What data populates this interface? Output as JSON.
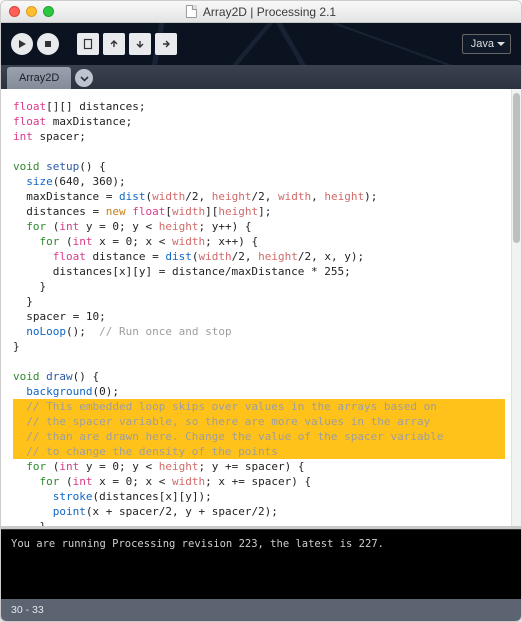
{
  "window": {
    "title": "Array2D | Processing 2.1"
  },
  "toolbar": {
    "mode_label": "Java"
  },
  "tabs": {
    "items": [
      {
        "label": "Array2D"
      }
    ]
  },
  "console": {
    "message": "You are running Processing revision 223, the latest is 227."
  },
  "status": {
    "selection": "30 - 33"
  },
  "code": {
    "l1_a": "float",
    "l1_b": "[][] distances;",
    "l2_a": "float",
    "l2_b": " maxDistance;",
    "l3_a": "int",
    "l3_b": " spacer;",
    "blank": " ",
    "l5_a": "void",
    "l5_b": " ",
    "l5_c": "setup",
    "l5_d": "() {",
    "l6_a": "  ",
    "l6_b": "size",
    "l6_c": "(640, 360);",
    "l7_a": "  maxDistance = ",
    "l7_b": "dist",
    "l7_c": "(",
    "l7_d": "width",
    "l7_e": "/2, ",
    "l7_f": "height",
    "l7_g": "/2, ",
    "l7_h": "width",
    "l7_i": ", ",
    "l7_j": "height",
    "l7_k": ");",
    "l8_a": "  distances = ",
    "l8_b": "new",
    "l8_c": " ",
    "l8_d": "float",
    "l8_e": "[",
    "l8_f": "width",
    "l8_g": "][",
    "l8_h": "height",
    "l8_i": "];",
    "l9_a": "  ",
    "l9_b": "for",
    "l9_c": " (",
    "l9_d": "int",
    "l9_e": " y = 0; y < ",
    "l9_f": "height",
    "l9_g": "; y++) {",
    "l10_a": "    ",
    "l10_b": "for",
    "l10_c": " (",
    "l10_d": "int",
    "l10_e": " x = 0; x < ",
    "l10_f": "width",
    "l10_g": "; x++) {",
    "l11_a": "      ",
    "l11_b": "float",
    "l11_c": " distance = ",
    "l11_d": "dist",
    "l11_e": "(",
    "l11_f": "width",
    "l11_g": "/2, ",
    "l11_h": "height",
    "l11_i": "/2, x, y);",
    "l12": "      distances[x][y] = distance/maxDistance * 255;",
    "l13": "    }",
    "l14": "  }",
    "l15": "  spacer = 10;",
    "l16_a": "  ",
    "l16_b": "noLoop",
    "l16_c": "();  ",
    "l16_d": "// Run once and stop",
    "l17": "}",
    "l19_a": "void",
    "l19_b": " ",
    "l19_c": "draw",
    "l19_d": "() {",
    "l20_a": "  ",
    "l20_b": "background",
    "l20_c": "(0);",
    "l21": "  // This embedded loop skips over values in the arrays based on ",
    "l22": "  // the spacer variable, so there are more values in the array ",
    "l23": "  // than are drawn here. Change the value of the spacer variable ",
    "l24": "  // to change the density of the points",
    "l25_a": "  ",
    "l25_b": "for",
    "l25_c": " (",
    "l25_d": "int",
    "l25_e": " y = 0; y < ",
    "l25_f": "height",
    "l25_g": "; y += spacer) {",
    "l26_a": "    ",
    "l26_b": "for",
    "l26_c": " (",
    "l26_d": "int",
    "l26_e": " x = 0; x < ",
    "l26_f": "width",
    "l26_g": "; x += spacer) {",
    "l27_a": "      ",
    "l27_b": "stroke",
    "l27_c": "(distances[x][y]);",
    "l28_a": "      ",
    "l28_b": "point",
    "l28_c": "(x + spacer/2, y + spacer/2);",
    "l29": "    }",
    "l30": "  }",
    "l31": "}"
  }
}
